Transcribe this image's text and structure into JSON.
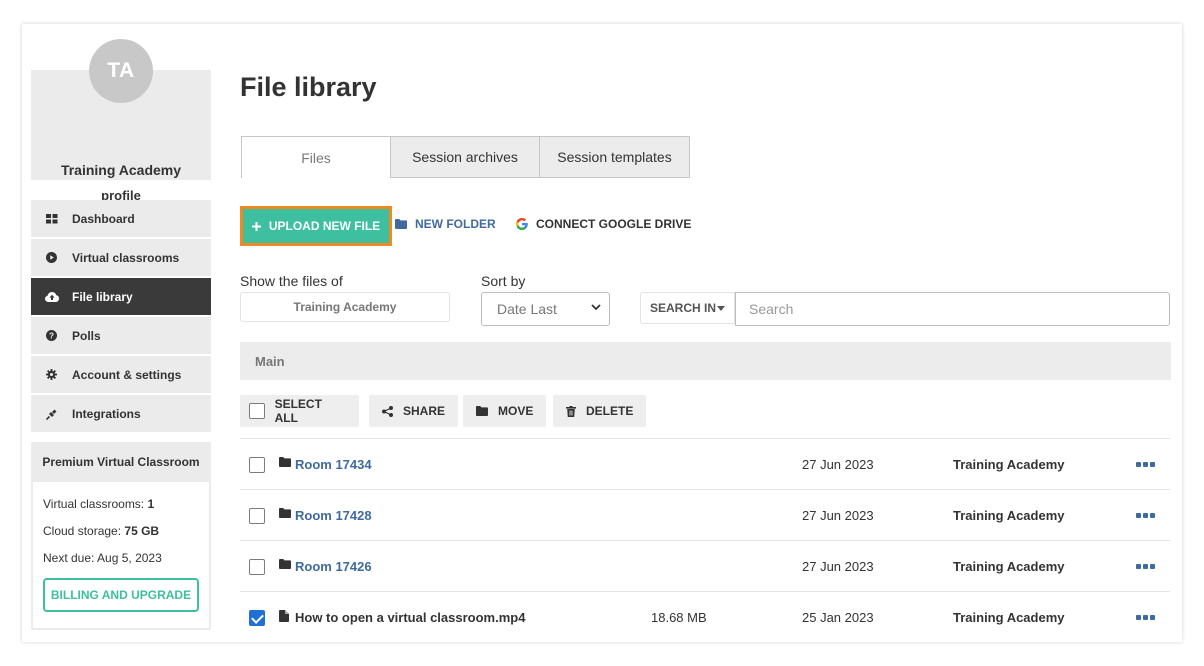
{
  "sidebar": {
    "avatar_initials": "TA",
    "org_name": "Training Academy",
    "profile_link": "profile",
    "nav": [
      {
        "label": "Dashboard",
        "icon": "dashboard-icon"
      },
      {
        "label": "Virtual classrooms",
        "icon": "play-circle-icon"
      },
      {
        "label": "File library",
        "icon": "cloud-upload-icon",
        "active": true
      },
      {
        "label": "Polls",
        "icon": "question-circle-icon"
      },
      {
        "label": "Account & settings",
        "icon": "gear-icon"
      },
      {
        "label": "Integrations",
        "icon": "plug-icon"
      }
    ],
    "plan": {
      "title": "Premium Virtual Classroom",
      "classrooms_label": "Virtual classrooms: ",
      "classrooms_value": "1",
      "storage_label": "Cloud storage: ",
      "storage_value": "75 GB",
      "next_due": "Next due: Aug 5, 2023",
      "billing_button": "BILLING AND UPGRADE"
    }
  },
  "main": {
    "title": "File library",
    "tabs": [
      {
        "label": "Files",
        "active": true
      },
      {
        "label": "Session archives"
      },
      {
        "label": "Session templates"
      }
    ],
    "toolbar": {
      "upload": "UPLOAD NEW FILE",
      "new_folder": "NEW FOLDER",
      "connect_drive": "CONNECT GOOGLE DRIVE"
    },
    "filters": {
      "show_files_label": "Show the files of",
      "show_files_value": "Training Academy",
      "sort_label": "Sort by",
      "sort_value": "Date Last",
      "search_in": "SEARCH IN",
      "search_placeholder": "Search"
    },
    "breadcrumb": "Main",
    "actions": {
      "select_all": "SELECT ALL",
      "share": "SHARE",
      "move": "MOVE",
      "delete": "DELETE"
    },
    "files": [
      {
        "name": "Room 17434",
        "type": "folder",
        "size": "",
        "date": "27 Jun 2023",
        "owner": "Training Academy",
        "checked": false
      },
      {
        "name": "Room 17428",
        "type": "folder",
        "size": "",
        "date": "27 Jun 2023",
        "owner": "Training Academy",
        "checked": false
      },
      {
        "name": "Room 17426",
        "type": "folder",
        "size": "",
        "date": "27 Jun 2023",
        "owner": "Training Academy",
        "checked": false
      },
      {
        "name": "How to open a virtual classroom.mp4",
        "type": "file",
        "size": "18.68 MB",
        "date": "25 Jan 2023",
        "owner": "Training Academy",
        "checked": true
      }
    ]
  },
  "colors": {
    "accent_green": "#3dbfa0",
    "highlight_orange": "#f0891f",
    "link_blue": "#3f6aa0",
    "active_nav": "#3a3a3a",
    "checkbox_blue": "#1f6fd6"
  }
}
